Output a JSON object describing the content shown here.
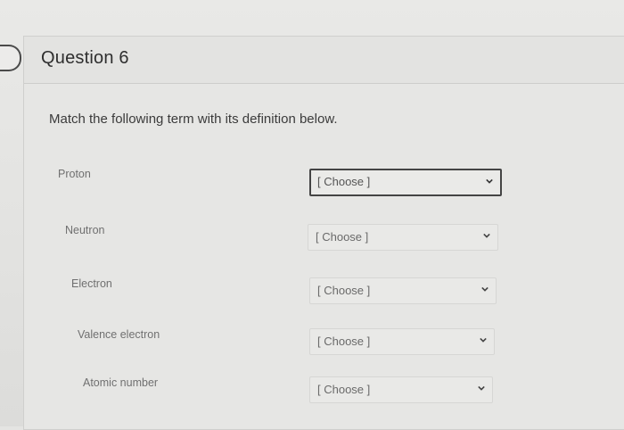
{
  "question": {
    "title": "Question 6",
    "prompt": "Match the following term with its definition below."
  },
  "matches": [
    {
      "term": "Proton",
      "selected": "[ Choose ]"
    },
    {
      "term": "Neutron",
      "selected": "[ Choose ]"
    },
    {
      "term": "Electron",
      "selected": "[ Choose ]"
    },
    {
      "term": "Valence electron",
      "selected": "[ Choose ]"
    },
    {
      "term": "Atomic number",
      "selected": "[ Choose ]"
    }
  ],
  "icons": {
    "collapse": "collapse-arrow-icon",
    "dropdown": "chevron-down-icon"
  },
  "colors": {
    "active_border": "#444444",
    "text": "#2e2e2e"
  }
}
